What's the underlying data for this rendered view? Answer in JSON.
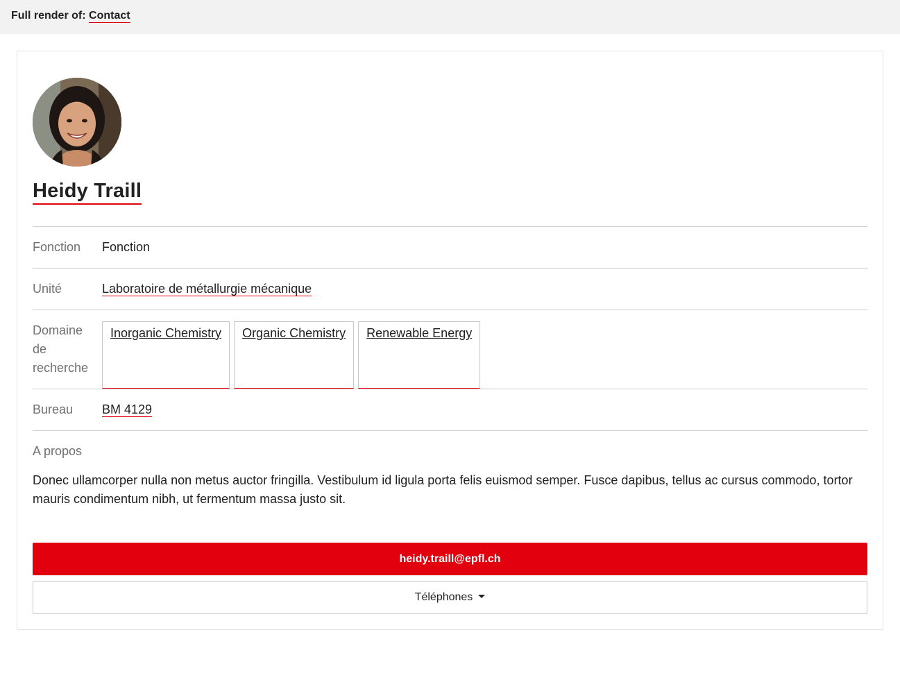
{
  "header": {
    "prefix": "Full render of:",
    "link_label": "Contact"
  },
  "person": {
    "name": "Heidy Traill"
  },
  "details": {
    "fonction": {
      "label": "Fonction",
      "value": "Fonction"
    },
    "unite": {
      "label": "Unité",
      "value": "Laboratoire de métallurgie mécanique"
    },
    "domaine": {
      "label_line1": "Domaine",
      "label_line2": "de",
      "label_line3": "recherche",
      "tags": [
        "Inorganic Chemistry",
        "Organic Chemistry",
        "Renewable Energy"
      ]
    },
    "bureau": {
      "label": "Bureau",
      "value": "BM 4129"
    },
    "apropos": {
      "label": "A propos",
      "text": "Donec ullamcorper nulla non metus auctor fringilla. Vestibulum id ligula porta felis euismod semper. Fusce dapibus, tellus ac cursus commodo, tortor mauris condimentum nibh, ut fermentum massa justo sit."
    }
  },
  "actions": {
    "email": "heidy.traill@epfl.ch",
    "phones_label": "Téléphones"
  },
  "colors": {
    "accent": "#e2000f",
    "topbar_bg": "#f2f2f3",
    "label_gray": "#707070"
  }
}
